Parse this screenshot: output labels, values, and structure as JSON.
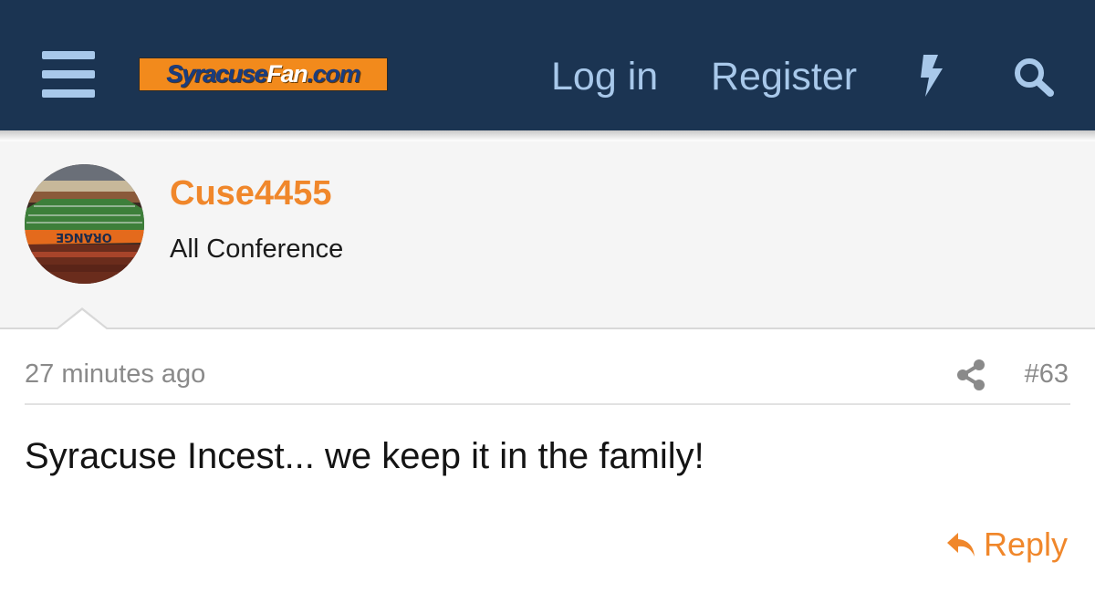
{
  "header": {
    "menu_icon": "hamburger-menu-icon",
    "logo": {
      "part1": "Syracuse",
      "part2": "Fan",
      "part3": ".com"
    },
    "login_label": "Log in",
    "register_label": "Register",
    "whats_new_icon": "lightning-bolt-icon",
    "search_icon": "search-icon",
    "colors": {
      "background": "#1b3452",
      "link": "#a8c8ea",
      "logo_bg": "#f28a1c"
    }
  },
  "user": {
    "avatar_icon": "stadium-avatar",
    "name": "Cuse4455",
    "title": "All Conference",
    "name_color": "#f0872b"
  },
  "post": {
    "timestamp": "27 minutes ago",
    "share_icon": "share-icon",
    "number": "#63",
    "body": "Syracuse Incest... we keep it in the family!",
    "reply_icon": "reply-arrow-icon",
    "reply_label": "Reply"
  }
}
